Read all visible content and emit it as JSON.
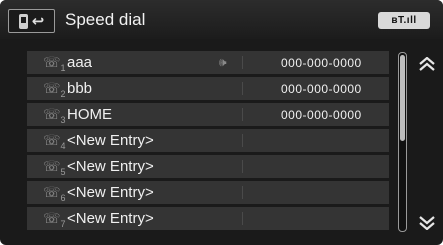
{
  "header": {
    "title": "Speed dial",
    "status_text": "ʙT.ıll"
  },
  "entries": [
    {
      "slot": "1",
      "name": "aaa",
      "voice_tag": true,
      "number": "000-000-0000"
    },
    {
      "slot": "2",
      "name": "bbb",
      "voice_tag": false,
      "number": "000-000-0000"
    },
    {
      "slot": "3",
      "name": "HOME",
      "voice_tag": false,
      "number": "000-000-0000"
    },
    {
      "slot": "4",
      "name": "<New Entry>",
      "voice_tag": false,
      "number": ""
    },
    {
      "slot": "5",
      "name": "<New Entry>",
      "voice_tag": false,
      "number": ""
    },
    {
      "slot": "6",
      "name": "<New Entry>",
      "voice_tag": false,
      "number": ""
    },
    {
      "slot": "7",
      "name": "<New Entry>",
      "voice_tag": false,
      "number": ""
    }
  ],
  "icons": {
    "menu": "phone-menu-icon",
    "back": "back-icon",
    "handset": "handset-icon",
    "voice_tag": "voice-tag-icon",
    "scroll_up": "double-chevron-up-icon",
    "scroll_down": "double-chevron-down-icon"
  },
  "colors": {
    "background": "#1a1a1a",
    "row": "#343434",
    "text": "#f0f0f0"
  }
}
